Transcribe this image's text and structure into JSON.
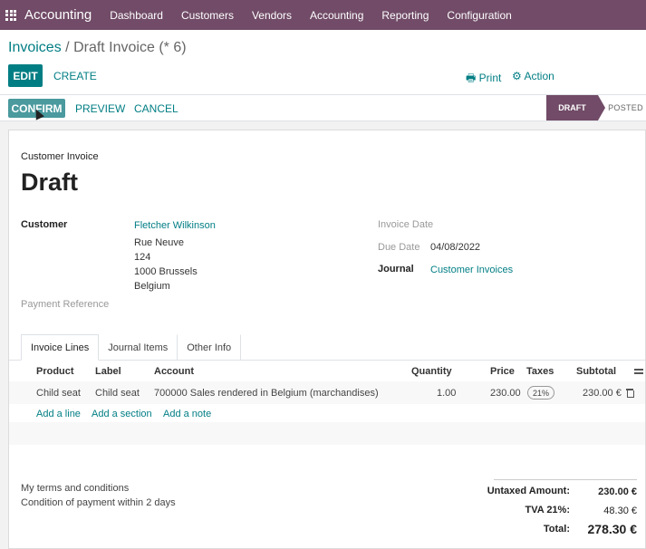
{
  "topbar": {
    "app_name": "Accounting",
    "menu": [
      "Dashboard",
      "Customers",
      "Vendors",
      "Accounting",
      "Reporting",
      "Configuration"
    ]
  },
  "breadcrumb": {
    "parent": "Invoices",
    "separator": "/",
    "current": "Draft Invoice (* 6)"
  },
  "control": {
    "edit": "EDIT",
    "create": "CREATE",
    "print": "Print",
    "action": "Action"
  },
  "statusbar": {
    "confirm": "CONFIRM",
    "preview": "PREVIEW",
    "cancel": "CANCEL",
    "stage_draft": "DRAFT",
    "stage_posted": "POSTED"
  },
  "invoice": {
    "type": "Customer Invoice",
    "title": "Draft",
    "customer_label": "Customer",
    "customer_name": "Fletcher Wilkinson",
    "address": [
      "Rue Neuve",
      "124",
      "1000 Brussels",
      "Belgium"
    ],
    "payment_ref_label": "Payment Reference",
    "invoice_date_label": "Invoice Date",
    "due_date_label": "Due Date",
    "due_date": "04/08/2022",
    "journal_label": "Journal",
    "journal": "Customer Invoices"
  },
  "tabs": [
    "Invoice Lines",
    "Journal Items",
    "Other Info"
  ],
  "lines": {
    "headers": {
      "product": "Product",
      "label": "Label",
      "account": "Account",
      "quantity": "Quantity",
      "price": "Price",
      "taxes": "Taxes",
      "subtotal": "Subtotal"
    },
    "rows": [
      {
        "product": "Child seat",
        "label": "Child seat",
        "account": "700000 Sales rendered in Belgium (marchandises)",
        "quantity": "1.00",
        "price": "230.00",
        "tax": "21%",
        "subtotal": "230.00 €"
      }
    ],
    "add_line": "Add a line",
    "add_section": "Add a section",
    "add_note": "Add a note"
  },
  "terms": [
    "My terms and conditions",
    "Condition of payment within 2 days"
  ],
  "totals": {
    "untaxed_label": "Untaxed Amount:",
    "untaxed": "230.00 €",
    "tva_label": "TVA 21%:",
    "tva": "48.30 €",
    "total_label": "Total:",
    "total": "278.30 €"
  }
}
